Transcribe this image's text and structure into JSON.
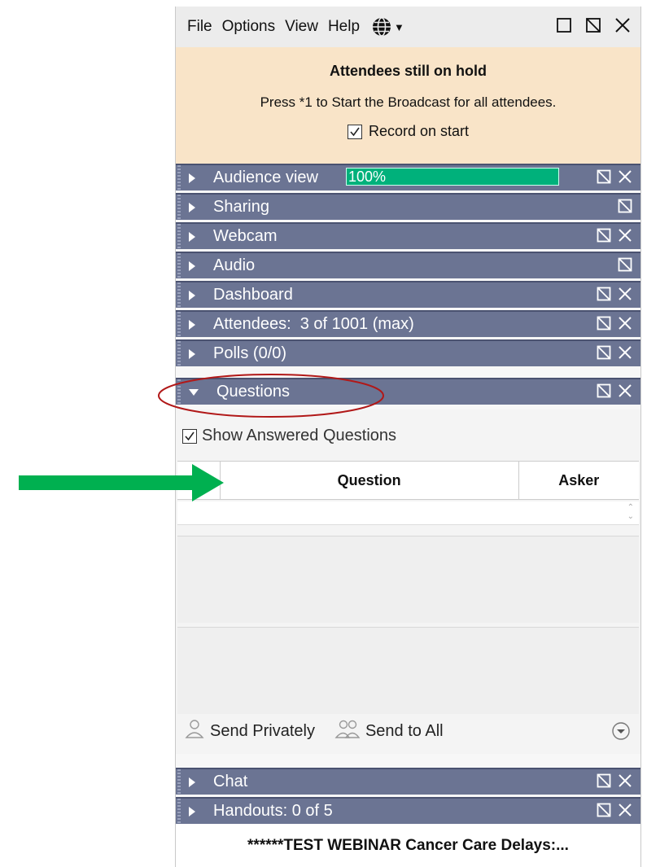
{
  "menu": {
    "items": [
      "File",
      "Options",
      "View",
      "Help"
    ],
    "globe_icon": "globe-icon"
  },
  "window_buttons": [
    "restore-icon",
    "popout-icon",
    "close-icon"
  ],
  "hold_banner": {
    "title": "Attendees still on hold",
    "message": "Press *1 to Start the Broadcast for all attendees.",
    "record_label": "Record on start",
    "record_checked": true
  },
  "sections": {
    "audience": {
      "label": "Audience view",
      "progress_text": "100%",
      "progress_percent": 100
    },
    "sharing": {
      "label": "Sharing"
    },
    "webcam": {
      "label": "Webcam"
    },
    "audio": {
      "label": "Audio"
    },
    "dashboard": {
      "label": "Dashboard"
    },
    "attendees": {
      "label": "Attendees:  3 of 1001 (max)"
    },
    "polls": {
      "label": "Polls (0/0)"
    },
    "questions": {
      "label": "Questions"
    },
    "chat": {
      "label": "Chat"
    },
    "handouts": {
      "label": "Handouts: 0 of 5"
    }
  },
  "questions": {
    "show_answered_label": "Show Answered Questions",
    "show_answered_checked": true,
    "columns": [
      "",
      "Question",
      "Asker"
    ],
    "send_privately_label": "Send Privately",
    "send_to_all_label": "Send to All"
  },
  "webinar_title": "******TEST WEBINAR Cancer Care Delays:...",
  "colors": {
    "header_bar": "#6b7493",
    "banner_bg": "#f9e4c8",
    "progress": "#00b17b",
    "arrow": "#00b050",
    "highlight_ellipse": "#b11818"
  }
}
